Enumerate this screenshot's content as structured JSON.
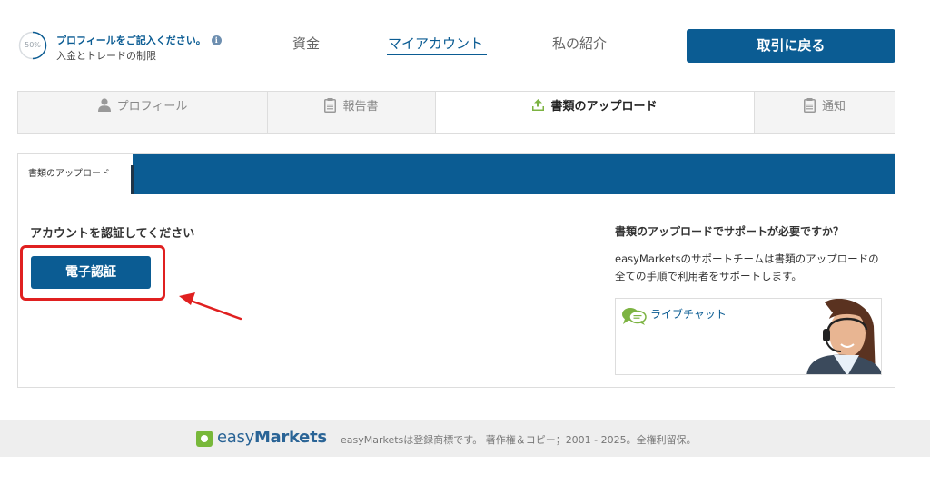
{
  "header": {
    "progress_percent": "50%",
    "profile_title": "プロフィールをご記入ください。",
    "profile_subtitle": "入金とトレードの制限",
    "nav": {
      "funds": "資金",
      "my_account": "マイアカウント",
      "referral": "私の紹介"
    },
    "back_button": "取引に戻る"
  },
  "tabs": {
    "profile": "プロフィール",
    "reports": "報告書",
    "upload": "書類のアップロード",
    "notifications": "通知"
  },
  "panel": {
    "tab_label": "書類のアップロード",
    "verify_title": "アカウントを認証してください",
    "verify_button": "電子認証",
    "help_title": "書類のアップロードでサポートが必要ですか？",
    "help_text": "easyMarketsのサポートチームは書類のアップロードの全ての手順で利用者をサポートします。",
    "chat_label": "ライブチャット"
  },
  "footer": {
    "logo_easy": "easy",
    "logo_markets": "Markets",
    "copyright": "easyMarketsは登録商標です。 著作権＆コピー；2001 - 2025。全権利留保。"
  },
  "colors": {
    "brand_blue": "#0b5c93",
    "highlight_red": "#e02020",
    "logo_green": "#78b83a"
  }
}
